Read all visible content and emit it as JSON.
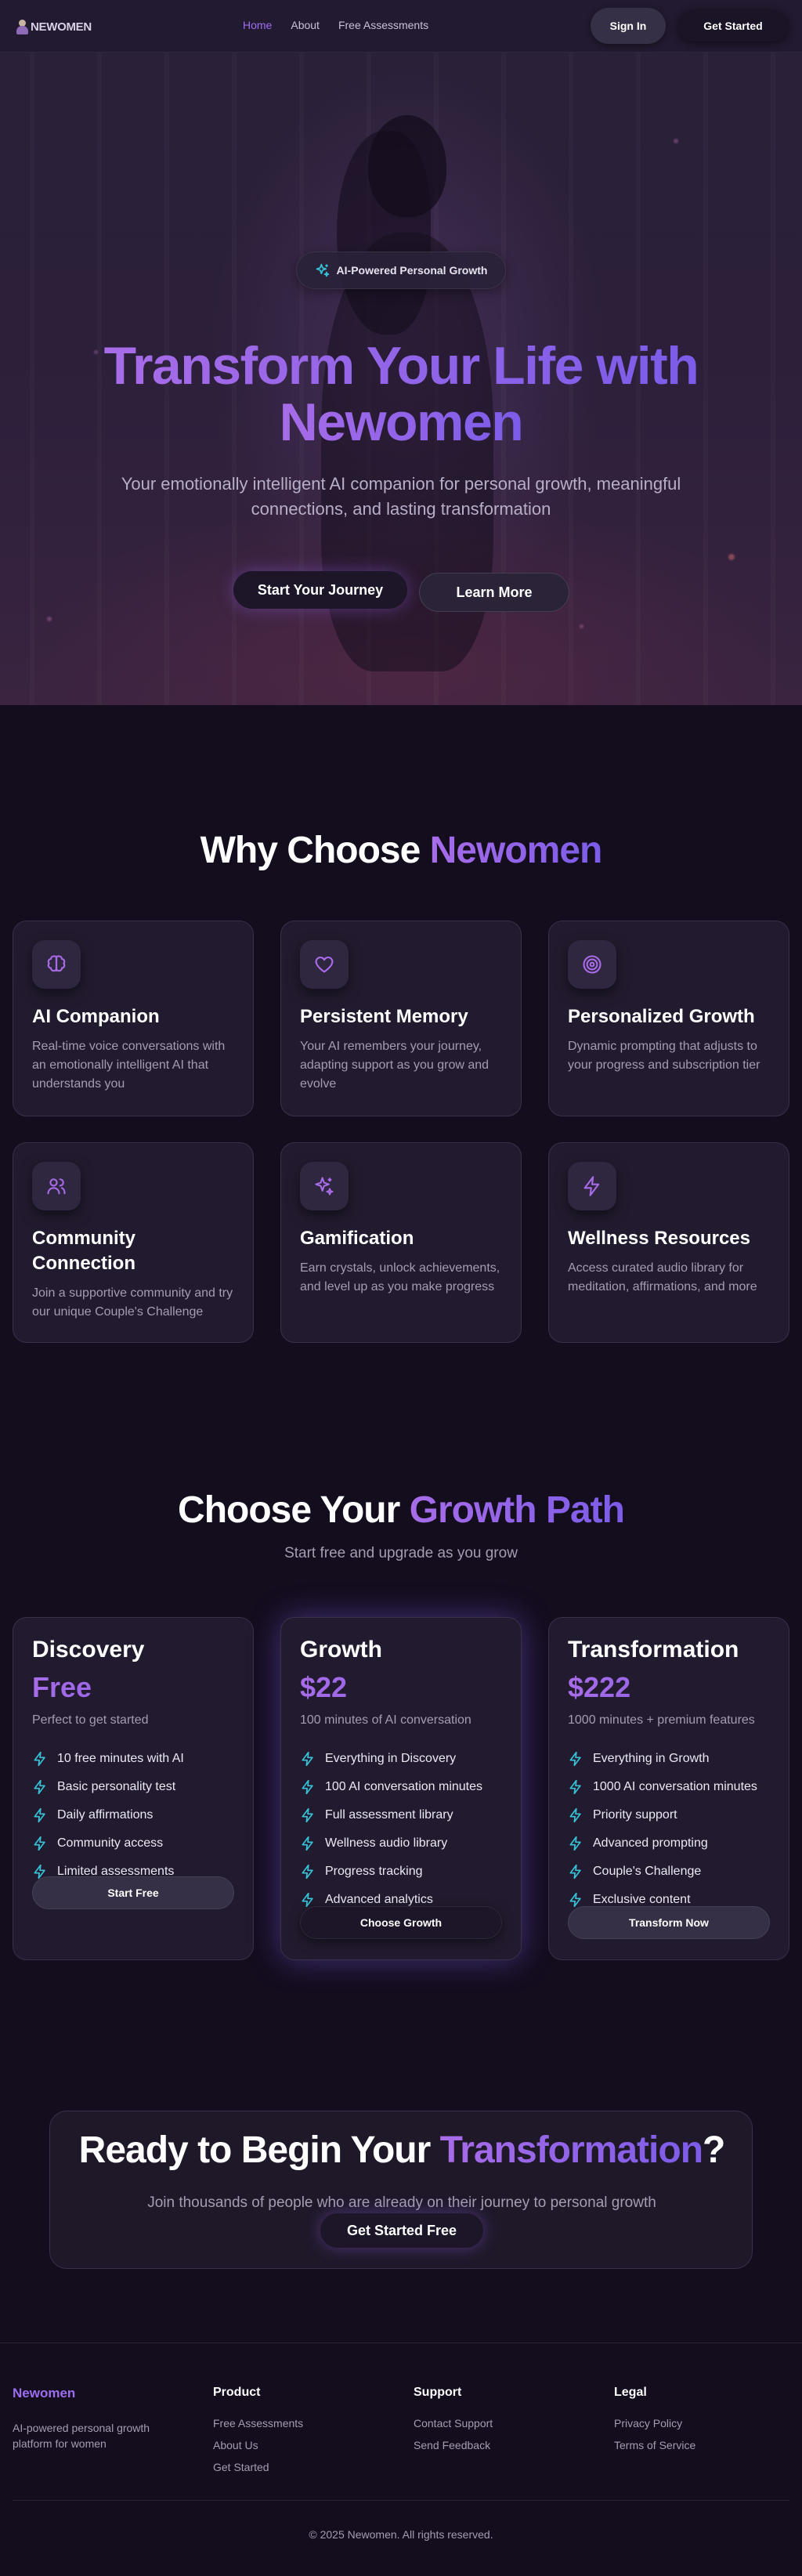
{
  "nav": {
    "logo": "NEWOMEN",
    "links": [
      "Home",
      "About",
      "Free Assessments"
    ],
    "signin": "Sign In",
    "get_started": "Get Started"
  },
  "hero": {
    "badge": "AI-Powered Personal Growth",
    "title_line1": "Transform Your Life with",
    "title_line2": "Newomen",
    "subtitle": "Your emotionally intelligent AI companion for personal growth, meaningful connections, and lasting transformation",
    "cta_primary": "Start Your Journey",
    "cta_secondary": "Learn More"
  },
  "why": {
    "title_plain": "Why Choose ",
    "title_accent": "Newomen",
    "features": [
      {
        "icon": "brain-icon",
        "title": "AI Companion",
        "desc": "Real-time voice conversations with an emotionally intelligent AI that understands you"
      },
      {
        "icon": "heart-icon",
        "title": "Persistent Memory",
        "desc": "Your AI remembers your journey, adapting support as you grow and evolve"
      },
      {
        "icon": "target-icon",
        "title": "Personalized Growth",
        "desc": "Dynamic prompting that adjusts to your progress and subscription tier"
      },
      {
        "icon": "users-icon",
        "title": "Community Connection",
        "desc": "Join a supportive community and try our unique Couple's Challenge"
      },
      {
        "icon": "sparkles-icon",
        "title": "Gamification",
        "desc": "Earn crystals, unlock achievements, and level up as you make progress"
      },
      {
        "icon": "zap-icon",
        "title": "Wellness Resources",
        "desc": "Access curated audio library for meditation, affirmations, and more"
      }
    ]
  },
  "pricing": {
    "title_plain": "Choose Your ",
    "title_accent": "Growth Path",
    "subtitle": "Start free and upgrade as you grow",
    "plans": [
      {
        "name": "Discovery",
        "price": "Free",
        "desc": "Perfect to get started",
        "features": [
          "10 free minutes with AI",
          "Basic personality test",
          "Daily affirmations",
          "Community access",
          "Limited assessments"
        ],
        "button": "Start Free"
      },
      {
        "name": "Growth",
        "price": "$22",
        "desc": "100 minutes of AI conversation",
        "features": [
          "Everything in Discovery",
          "100 AI conversation minutes",
          "Full assessment library",
          "Wellness audio library",
          "Progress tracking",
          "Advanced analytics"
        ],
        "button": "Choose Growth"
      },
      {
        "name": "Transformation",
        "price": "$222",
        "desc": "1000 minutes + premium features",
        "features": [
          "Everything in Growth",
          "1000 AI conversation minutes",
          "Priority support",
          "Advanced prompting",
          "Couple's Challenge",
          "Exclusive content"
        ],
        "button": "Transform Now"
      }
    ]
  },
  "cta": {
    "title_plain": "Ready to Begin Your ",
    "title_accent": "Transformation",
    "title_end": "?",
    "subtitle": "Join thousands of people who are already on their journey to personal growth",
    "button": "Get Started Free"
  },
  "footer": {
    "brand": "Newomen",
    "tagline": "AI-powered personal growth platform for women",
    "columns": [
      {
        "title": "Product",
        "links": [
          "Free Assessments",
          "About Us",
          "Get Started"
        ]
      },
      {
        "title": "Support",
        "links": [
          "Contact Support",
          "Send Feedback"
        ]
      },
      {
        "title": "Legal",
        "links": [
          "Privacy Policy",
          "Terms of Service"
        ]
      }
    ],
    "copyright": "© 2025 Newomen. All rights reserved."
  },
  "colors": {
    "accent_purple": "#a86ce8",
    "accent_violet": "#7b5ce8",
    "check_cyan": "#38c4d8",
    "background": "#130d1e",
    "card": "#221b2f"
  }
}
